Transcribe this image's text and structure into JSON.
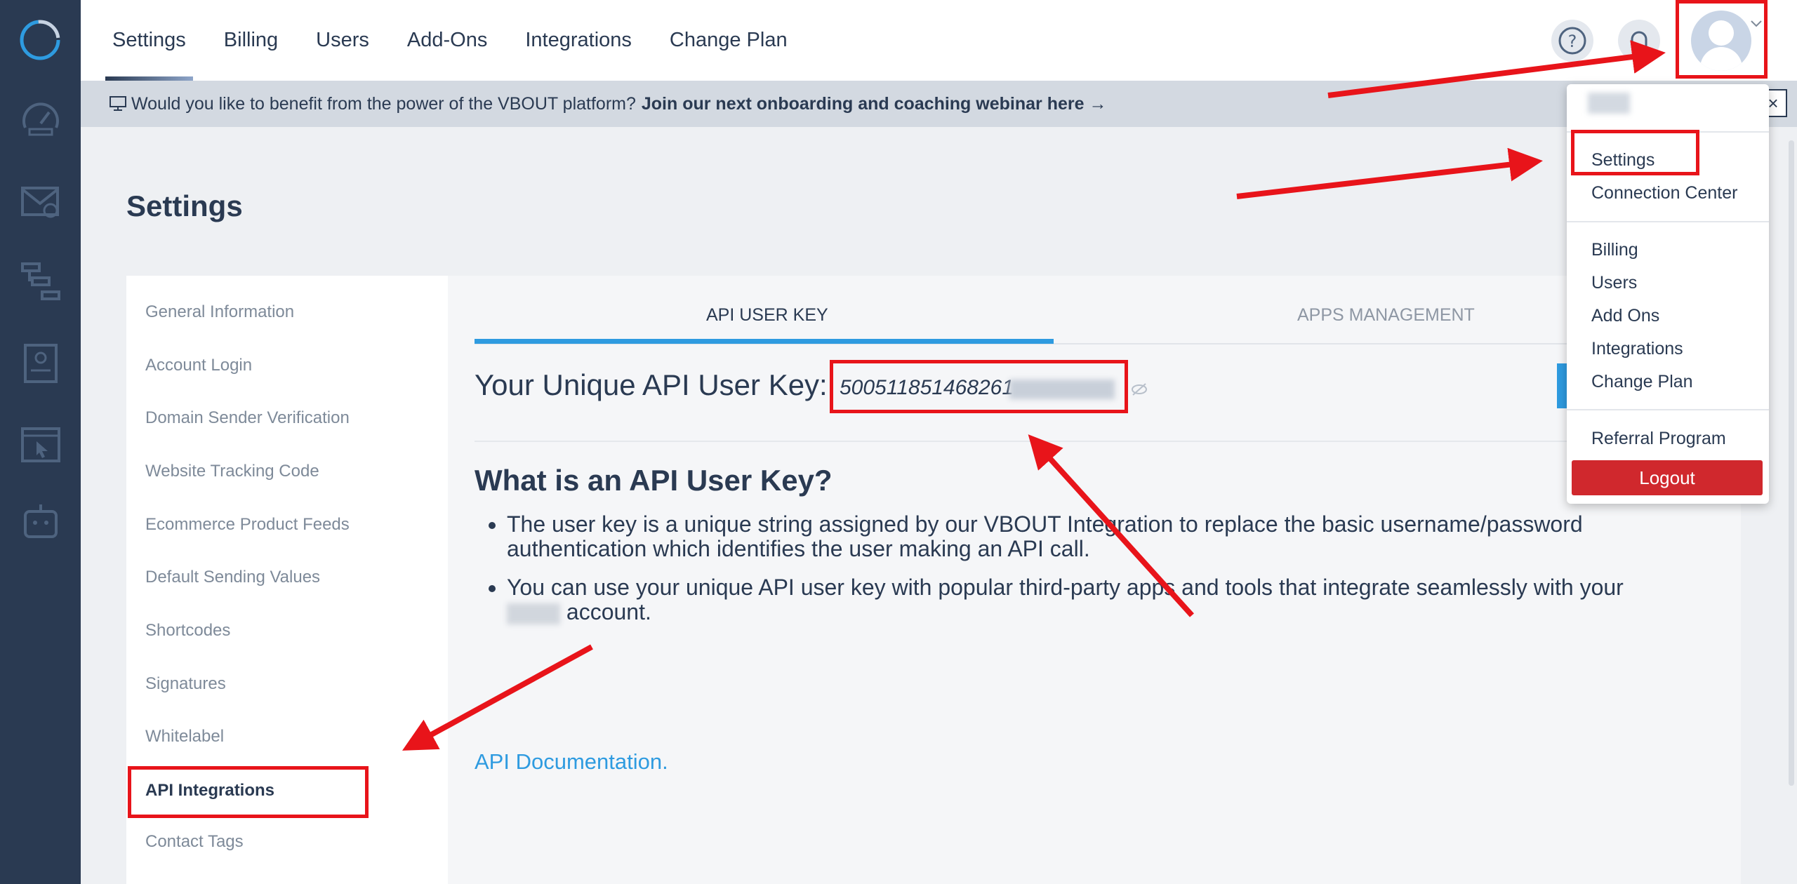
{
  "colors": {
    "accent": "#2e9be0",
    "highlight": "#e8141a",
    "dark": "#2a3a52",
    "logout": "#d0282d"
  },
  "rail": {
    "icons": [
      "vbout-logo-icon",
      "dashboard-gauge-icon",
      "email-icon",
      "automation-flow-icon",
      "landing-page-icon",
      "website-cursor-icon",
      "bot-icon"
    ]
  },
  "topnav": {
    "tabs": [
      {
        "label": "Settings",
        "active": true
      },
      {
        "label": "Billing"
      },
      {
        "label": "Users"
      },
      {
        "label": "Add-Ons"
      },
      {
        "label": "Integrations"
      },
      {
        "label": "Change Plan"
      }
    ]
  },
  "banner": {
    "text": "Would you like to benefit from the power of the VBOUT platform?",
    "link": "Join our next onboarding and coaching webinar here →",
    "close": "×"
  },
  "page_title": "Settings",
  "sidebar": {
    "items": [
      {
        "label": "General Information"
      },
      {
        "label": "Account Login"
      },
      {
        "label": "Domain Sender Verification"
      },
      {
        "label": "Website Tracking Code"
      },
      {
        "label": "Ecommerce Product Feeds"
      },
      {
        "label": "Default Sending Values"
      },
      {
        "label": "Shortcodes"
      },
      {
        "label": "Signatures"
      },
      {
        "label": "Whitelabel"
      },
      {
        "label": "API Integrations",
        "active": true
      },
      {
        "label": "Contact Tags"
      }
    ]
  },
  "main": {
    "tabs": [
      {
        "label": "API USER KEY",
        "active": true
      },
      {
        "label": "APPS MANAGEMENT"
      }
    ],
    "key_label": "Your Unique API User Key:",
    "key_value": "500511851468261",
    "heading": "What is an API User Key?",
    "bullets": [
      "The user key is a unique string assigned by our VBOUT Integration to replace the basic username/password authentication which identifies the user making an API call.",
      "You can use your unique API user key with popular third-party apps and tools that integrate seamlessly with your"
    ],
    "bullet2_tail": "account.",
    "doc_link": "API Documentation."
  },
  "dropdown": {
    "items_group1": [
      "Settings",
      "Connection Center"
    ],
    "items_group2": [
      "Billing",
      "Users",
      "Add Ons",
      "Integrations",
      "Change Plan"
    ],
    "items_group3": [
      "Referral Program"
    ],
    "logout": "Logout"
  }
}
